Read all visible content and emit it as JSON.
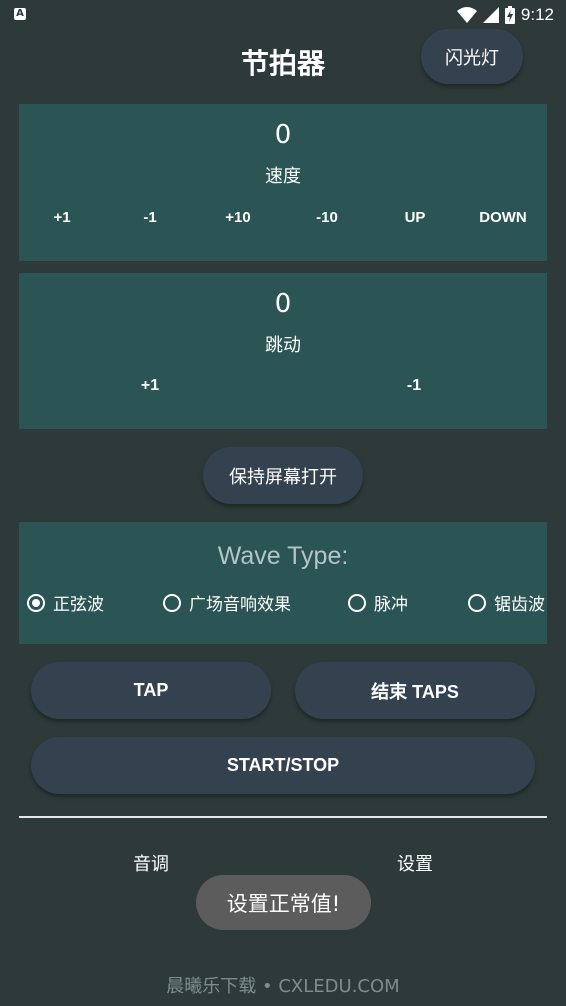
{
  "status_bar": {
    "time": "9:12",
    "app_icon": "A"
  },
  "header": {
    "title": "节拍器",
    "flash_button": "闪光灯"
  },
  "speed_panel": {
    "value": "0",
    "label": "速度",
    "controls": [
      "+1",
      "-1",
      "+10",
      "-10",
      "UP",
      "DOWN"
    ]
  },
  "beat_panel": {
    "value": "0",
    "label": "跳动",
    "controls": [
      "+1",
      "-1"
    ]
  },
  "keep_screen_button": "保持屏幕打开",
  "wave_panel": {
    "title": "Wave Type:",
    "options": [
      "正弦波",
      "广场音响效果",
      "脉冲",
      "锯齿波"
    ],
    "selected": "正弦波"
  },
  "buttons": {
    "tap": "TAP",
    "end_taps": "结束 TAPS",
    "start_stop": "START/STOP"
  },
  "bottom_tabs": [
    "音调",
    "设置"
  ],
  "toast": "设置正常值!",
  "watermark": "晨曦乐下载 • CXLEDU.COM"
}
